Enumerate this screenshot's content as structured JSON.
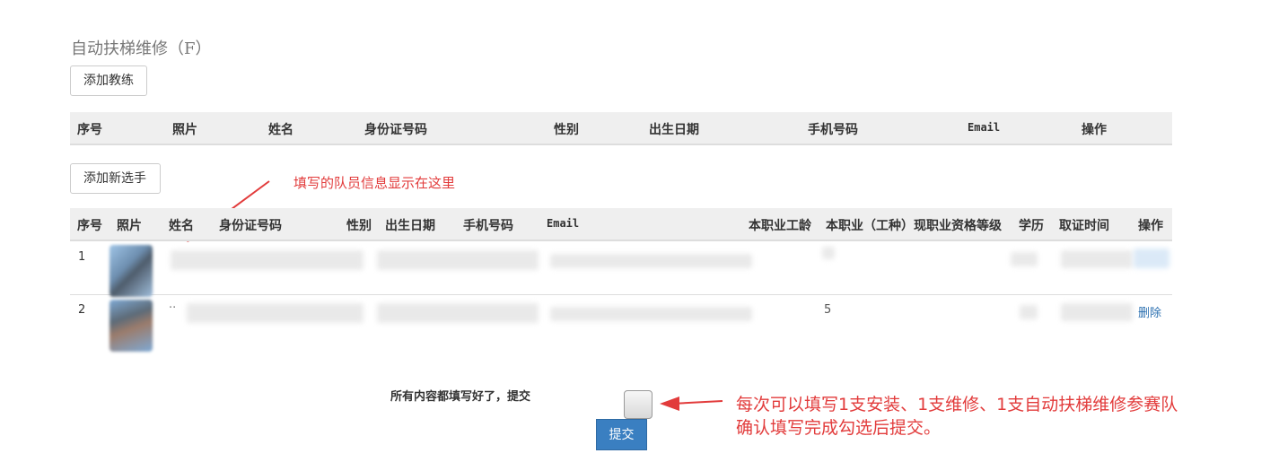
{
  "section": {
    "title": "自动扶梯维修（F）"
  },
  "coach": {
    "add_button": "添加教练",
    "headers": [
      "序号",
      "照片",
      "姓名",
      "身份证号码",
      "性别",
      "出生日期",
      "手机号码",
      "Email",
      "操作"
    ]
  },
  "players": {
    "add_button": "添加新选手",
    "headers": [
      "序号",
      "照片",
      "姓名",
      "身份证号码",
      "性别",
      "出生日期",
      "手机号码",
      "Email",
      "本职业工龄",
      "本职业（工种）",
      "现职业资格等级",
      "学历",
      "取证时间",
      "操作"
    ],
    "rows": [
      {
        "index": "1",
        "partial_name": "",
        "partial_level": "",
        "action": ""
      },
      {
        "index": "2",
        "partial_name": "··",
        "partial_level": "5",
        "action": "删除"
      }
    ]
  },
  "annotations": {
    "top": "填写的队员信息显示在这里",
    "bottom_line1": "每次可以填写1支安装、1支维修、1支自动扶梯维修参赛队",
    "bottom_line2": "确认填写完成勾选后提交。"
  },
  "confirm": {
    "label": "所有内容都填写好了，提交",
    "submit": "提交",
    "checked": false
  },
  "colors": {
    "annotation_red": "#e23b3b",
    "submit_blue": "#3a7fc1",
    "header_bg": "#efefef"
  }
}
